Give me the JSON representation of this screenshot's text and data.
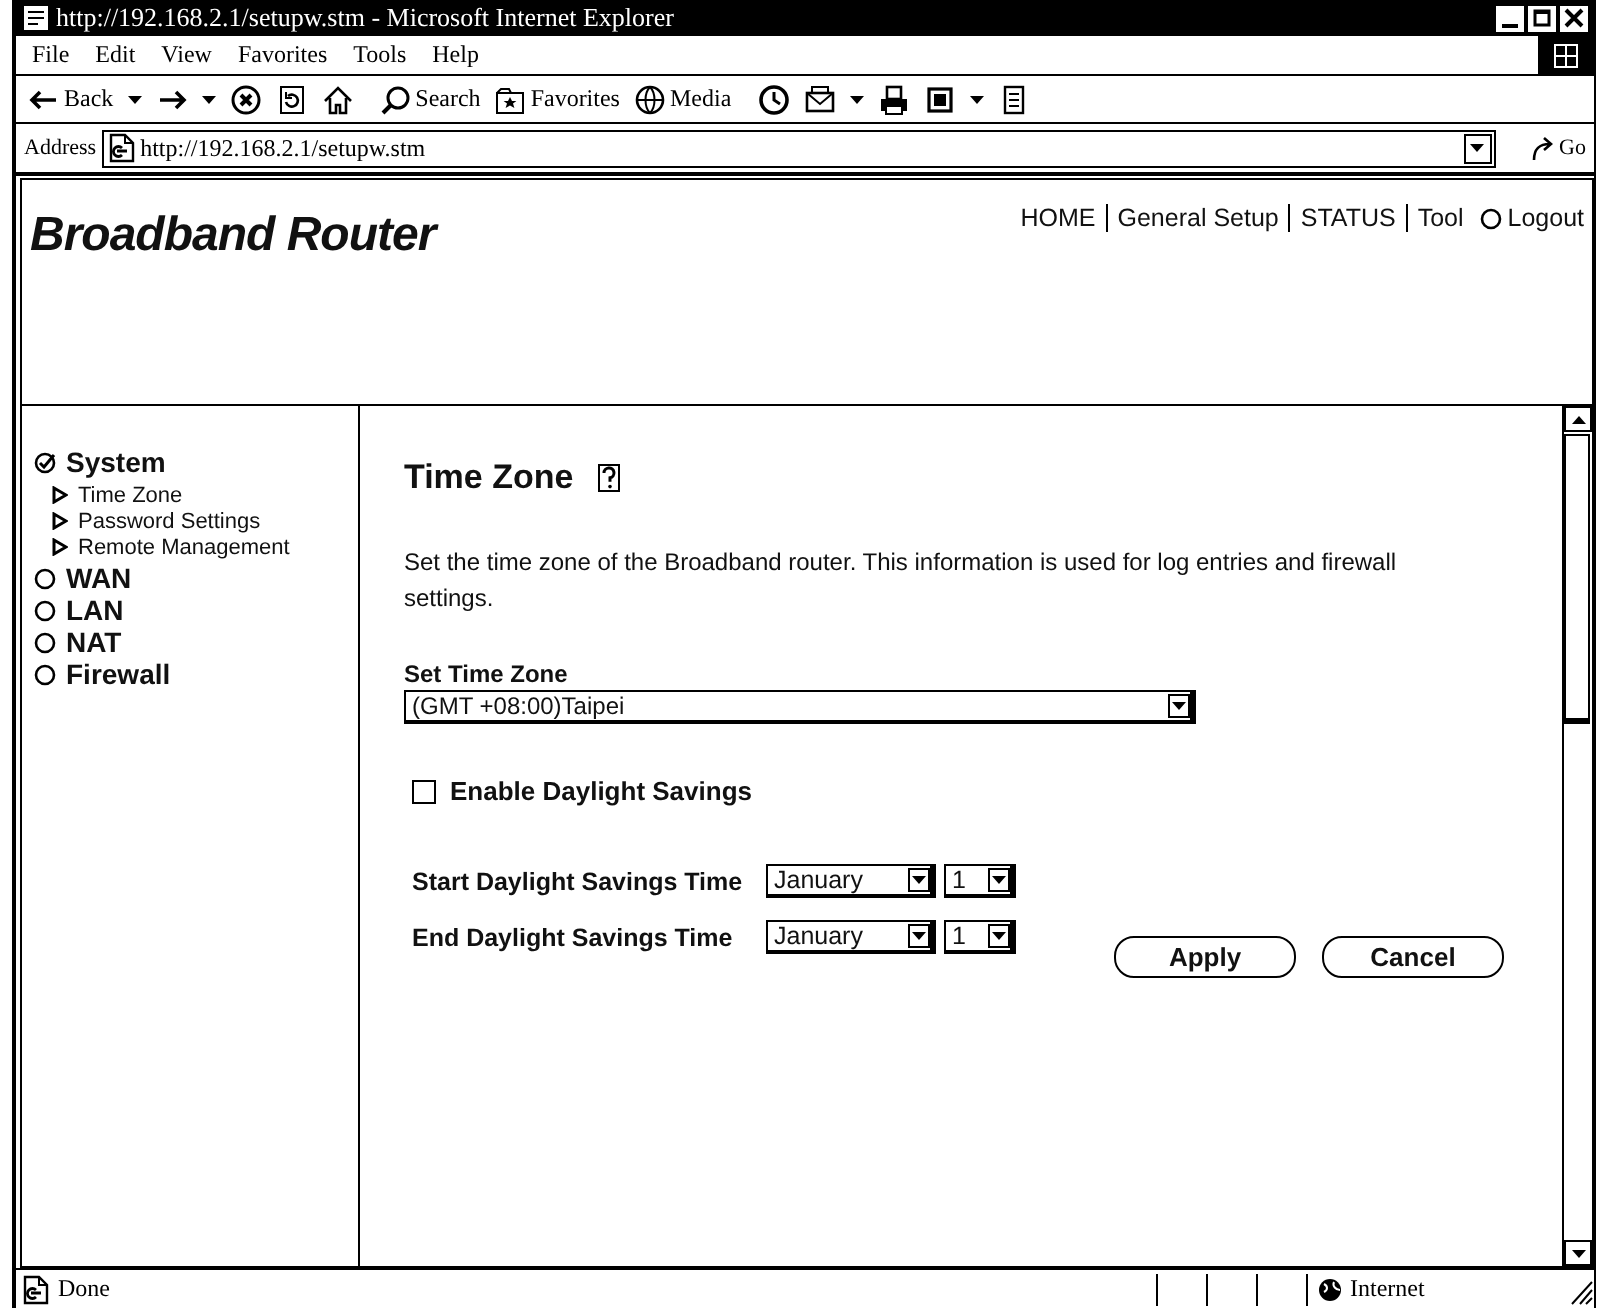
{
  "window": {
    "title": "http://192.168.2.1/setupw.stm - Microsoft Internet Explorer"
  },
  "menu": [
    "File",
    "Edit",
    "View",
    "Favorites",
    "Tools",
    "Help"
  ],
  "toolbar": [
    {
      "kind": "back",
      "label": "Back",
      "dropdown": true
    },
    {
      "kind": "forward",
      "dropdown": true
    },
    {
      "kind": "stop",
      "dropdown": false
    },
    {
      "kind": "refresh",
      "dropdown": false
    },
    {
      "kind": "home",
      "dropdown": false
    },
    {
      "kind": "search",
      "label": "Search",
      "dropdown": false
    },
    {
      "kind": "favorites",
      "label": "Favorites",
      "dropdown": false
    },
    {
      "kind": "media",
      "label": "Media",
      "dropdown": false
    },
    {
      "kind": "history",
      "dropdown": false
    },
    {
      "kind": "mail",
      "dropdown": true
    },
    {
      "kind": "print",
      "dropdown": false
    },
    {
      "kind": "edit",
      "dropdown": true
    },
    {
      "kind": "page",
      "dropdown": false
    }
  ],
  "address": {
    "label": "Address",
    "url": "http://192.168.2.1/setupw.stm",
    "go": "Go"
  },
  "header": {
    "logo": "Broadband Router",
    "nav": [
      {
        "kind": "link",
        "label": "HOME"
      },
      {
        "kind": "link",
        "label": "General Setup"
      },
      {
        "kind": "link",
        "label": "STATUS"
      },
      {
        "kind": "link",
        "label": "Tool"
      },
      {
        "kind": "logout",
        "label": "Logout"
      }
    ]
  },
  "sidebar": [
    {
      "label": "System",
      "expanded": true,
      "children": [
        {
          "label": "Time Zone"
        },
        {
          "label": "Password Settings"
        },
        {
          "label": "Remote Management"
        }
      ]
    },
    {
      "label": "WAN",
      "expanded": false
    },
    {
      "label": "LAN",
      "expanded": false
    },
    {
      "label": "NAT",
      "expanded": false
    },
    {
      "label": "Firewall",
      "expanded": false
    }
  ],
  "content": {
    "title": "Time Zone",
    "description": "Set the time zone of the Broadband router. This information is used for log entries and firewall settings.",
    "time_zone": {
      "label": "Set Time Zone",
      "value": "(GMT +08:00)Taipei"
    },
    "daylight": {
      "label": "Enable Daylight Savings",
      "checked": false
    },
    "rows": [
      {
        "label": "Start Daylight Savings Time",
        "month": "January",
        "day": "1"
      },
      {
        "label": "End Daylight Savings Time",
        "month": "January",
        "day": "1"
      }
    ],
    "buttons": [
      "Apply",
      "Cancel"
    ]
  },
  "status_bar": {
    "text": "Done",
    "zone": "Internet"
  }
}
